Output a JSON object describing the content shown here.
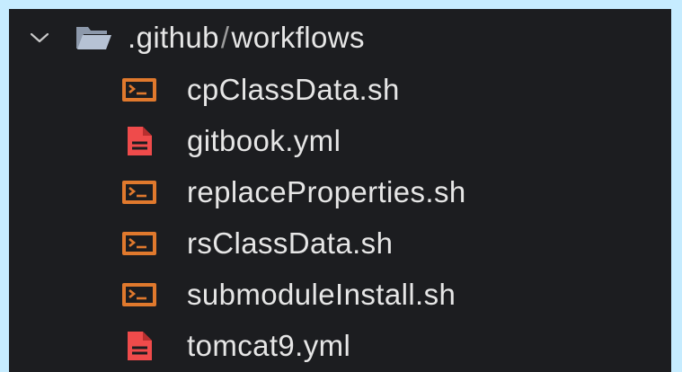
{
  "explorer": {
    "folder": {
      "name": ".github",
      "separator": "/",
      "subfolder": "workflows",
      "expanded": true,
      "icon": "folder-open-icon"
    },
    "files": [
      {
        "name": "cpClassData.sh",
        "icon": "shell-script-icon"
      },
      {
        "name": "gitbook.yml",
        "icon": "yaml-file-icon"
      },
      {
        "name": "replaceProperties.sh",
        "icon": "shell-script-icon"
      },
      {
        "name": "rsClassData.sh",
        "icon": "shell-script-icon"
      },
      {
        "name": "submoduleInstall.sh",
        "icon": "shell-script-icon"
      },
      {
        "name": "tomcat9.yml",
        "icon": "yaml-file-icon"
      }
    ]
  },
  "colors": {
    "background": "#1c1d20",
    "frame": "#c6ecff",
    "text": "#e6e6e6",
    "shell_icon": "#e0792d",
    "yaml_icon": "#ef4b4b",
    "folder_icon": "#a8b5c8"
  }
}
